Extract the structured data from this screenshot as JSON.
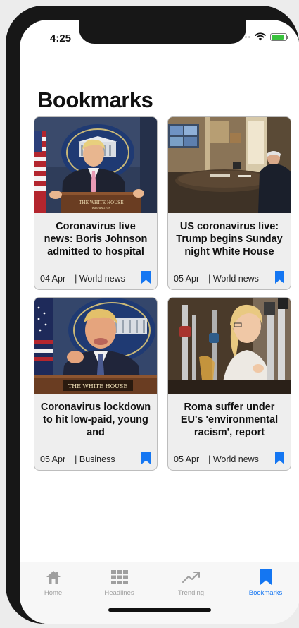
{
  "status_bar": {
    "time": "4:25",
    "icons": [
      "signal-dots",
      "wifi-icon",
      "battery-charging-icon"
    ],
    "battery_level": 0.85
  },
  "page": {
    "title": "Bookmarks"
  },
  "articles": [
    {
      "headline": "Coronavirus live news: Boris Johnson admitted to hospital",
      "date": "04 Apr",
      "category": "| World news",
      "image": "trump-podium-photo",
      "bookmarked": true
    },
    {
      "headline": "US coronavirus live: Trump begins Sunday night White House",
      "date": "05 Apr",
      "category": "| World news",
      "image": "office-desk-photo",
      "bookmarked": true
    },
    {
      "headline": "Coronavirus lockdown to hit low-paid, young and",
      "date": "05 Apr",
      "category": "| Business",
      "image": "trump-speaking-photo",
      "bookmarked": true
    },
    {
      "headline": "Roma suffer under EU's 'environmental racism', report",
      "date": "05 Apr",
      "category": "| World news",
      "image": "bar-tap-photo",
      "bookmarked": true
    }
  ],
  "photo_text": {
    "white_house_sign": "THE WHITE HOUSE",
    "white_house_sub": "WASHINGTON"
  },
  "tab_bar": {
    "tabs": [
      {
        "label": "Home",
        "icon": "home-icon",
        "active": false
      },
      {
        "label": "Headlines",
        "icon": "grid-icon",
        "active": false
      },
      {
        "label": "Trending",
        "icon": "trending-icon",
        "active": false
      },
      {
        "label": "Bookmarks",
        "icon": "bookmark-icon",
        "active": true
      }
    ]
  },
  "colors": {
    "accent": "#1476f2",
    "inactive": "#a0a0a0",
    "card_background": "#eeeeee"
  }
}
